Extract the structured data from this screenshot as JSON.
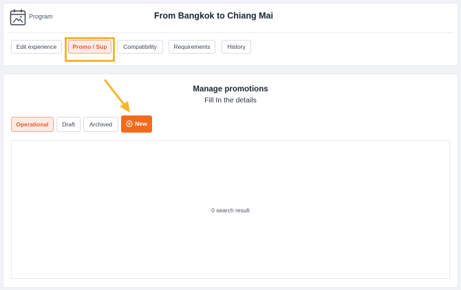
{
  "header": {
    "program_label": "Program",
    "title": "From Bangkok to Chiang Mai",
    "program_icon": "calendar-image-icon"
  },
  "tabs": [
    {
      "label": "Edit experience",
      "active": false
    },
    {
      "label": "Promo / Sup",
      "active": true
    },
    {
      "label": "Compatibility",
      "active": false
    },
    {
      "label": "Requirements",
      "active": false
    },
    {
      "label": "History",
      "active": false
    }
  ],
  "promotions": {
    "title": "Manage promotions",
    "subtitle": "Fill In the details",
    "filters": [
      {
        "label": "Operational",
        "active": true
      },
      {
        "label": "Draft",
        "active": false
      },
      {
        "label": "Archived",
        "active": false
      }
    ],
    "new_button_label": "New",
    "new_button_icon": "plus-circle-icon",
    "results_text": "0 search result"
  },
  "colors": {
    "accent": "#f26b1d",
    "active_tab_bg": "#fdece6",
    "annotation": "#f5b62a"
  }
}
